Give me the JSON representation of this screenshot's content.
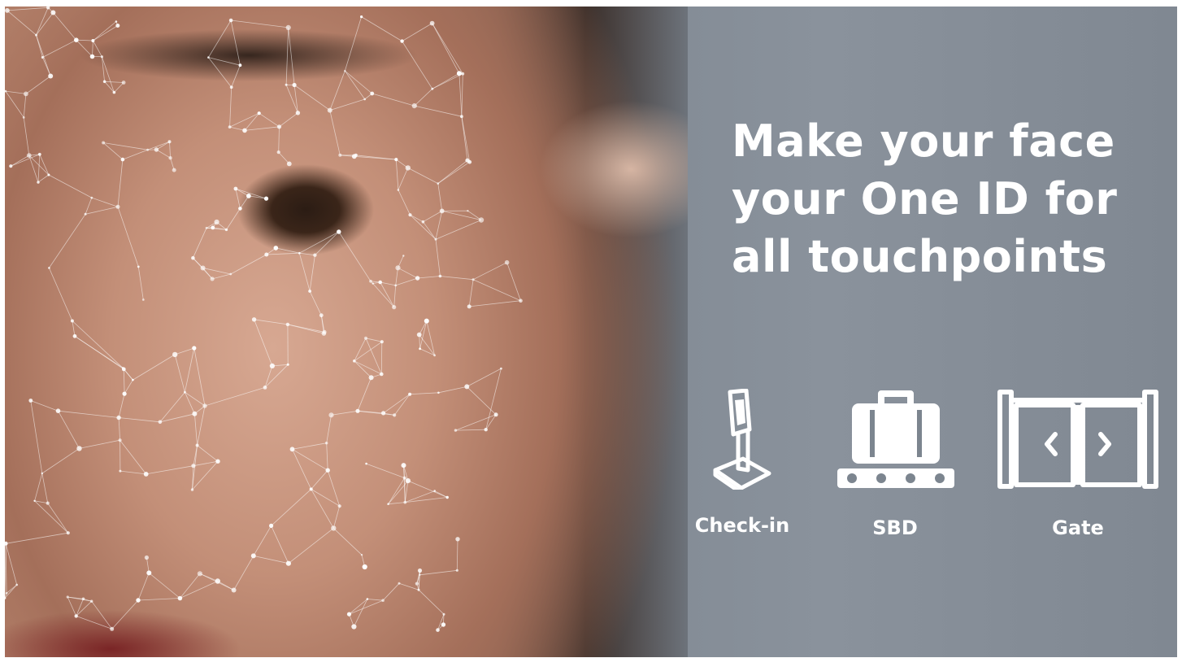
{
  "headline": {
    "line1": "Make your face",
    "line2": "your One ID for",
    "line3": "all touchpoints"
  },
  "touchpoints": [
    {
      "label": "Check-in",
      "icon": "kiosk-icon"
    },
    {
      "label": "SBD",
      "icon": "baggage-icon"
    },
    {
      "label": "Gate",
      "icon": "gate-icon"
    }
  ],
  "colors": {
    "text": "#ffffff",
    "background": "#7c858f",
    "skin": "#c69a85"
  }
}
